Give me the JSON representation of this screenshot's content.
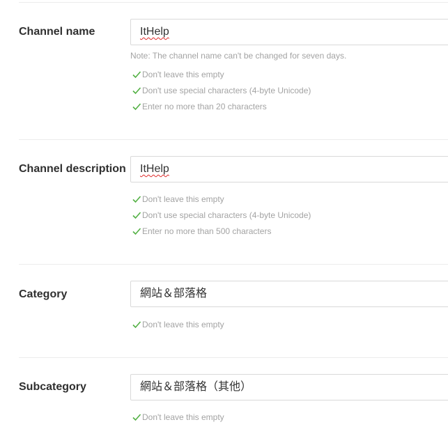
{
  "colors": {
    "check": "#52b043",
    "hint": "#a3a3a3",
    "divider": "#ececec",
    "border": "#d9d9d9",
    "spellcheck": "#e02b2b"
  },
  "channel_name": {
    "label": "Channel name",
    "value": "ItHelp",
    "note": "Note: The channel name can't be changed for seven days.",
    "rules": [
      "Don't leave this empty",
      "Don't use special characters (4-byte Unicode)",
      "Enter no more than 20 characters"
    ]
  },
  "channel_description": {
    "label": "Channel description",
    "value": "ItHelp",
    "rules": [
      "Don't leave this empty",
      "Don't use special characters (4-byte Unicode)",
      "Enter no more than 500 characters"
    ]
  },
  "category": {
    "label": "Category",
    "value": "網站＆部落格",
    "rules": [
      "Don't leave this empty"
    ]
  },
  "subcategory": {
    "label": "Subcategory",
    "value": "網站＆部落格（其他）",
    "rules": [
      "Don't leave this empty"
    ]
  }
}
